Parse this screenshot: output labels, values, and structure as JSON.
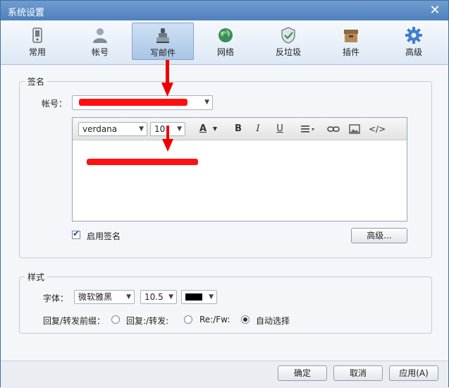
{
  "window": {
    "title": "系统设置",
    "close_glyph": "✕"
  },
  "toolbar": {
    "tabs": [
      {
        "label": "常用",
        "icon": "phone-icon"
      },
      {
        "label": "帐号",
        "icon": "user-icon"
      },
      {
        "label": "写邮件",
        "icon": "stamp-icon",
        "active": true
      },
      {
        "label": "网络",
        "icon": "globe-icon"
      },
      {
        "label": "反垃圾",
        "icon": "shield-icon"
      },
      {
        "label": "插件",
        "icon": "box-icon"
      },
      {
        "label": "高级",
        "icon": "gear-icon"
      }
    ]
  },
  "signature": {
    "group_label": "签名",
    "account_label": "帐号：",
    "account_value": "",
    "font_value": "verdana",
    "size_value": "10",
    "enable_label": "启用签名",
    "enable_checked": true,
    "advanced_button": "高级..."
  },
  "style": {
    "group_label": "样式",
    "font_label": "字体：",
    "font_value": "微软雅黑",
    "size_value": "10.5",
    "color_value": "#000000",
    "prefix_label": "回复/转发前缀：",
    "options": [
      "回复:/转发:",
      "Re:/Fw:",
      "自动选择"
    ],
    "selected": 2
  },
  "buttons": {
    "ok": "确定",
    "cancel": "取消",
    "apply": "应用(A)"
  },
  "colors": {
    "accent": "#4f81bd",
    "redaction": "#ff1010"
  }
}
